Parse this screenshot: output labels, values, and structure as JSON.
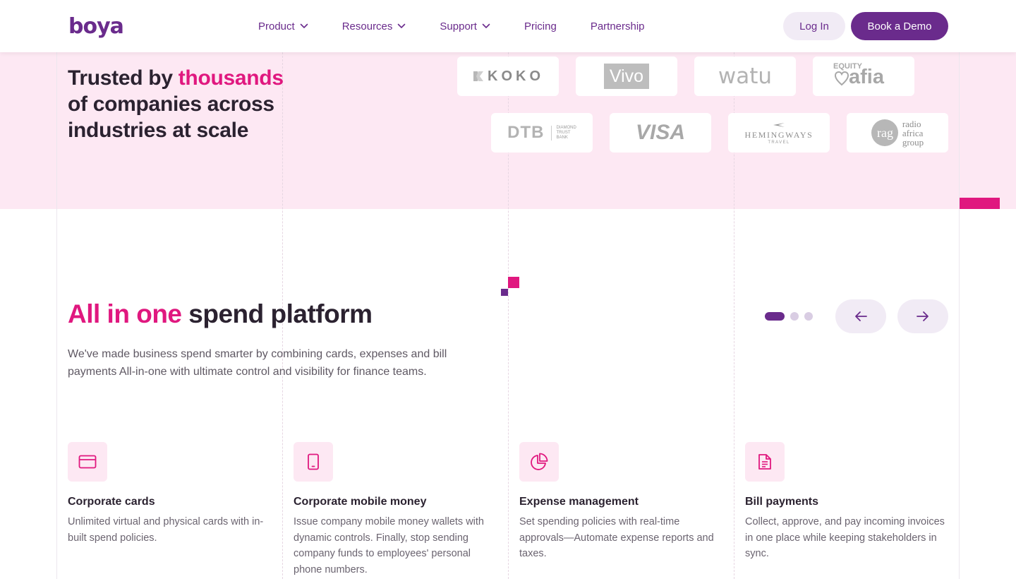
{
  "header": {
    "logo_text": "boya",
    "nav": [
      {
        "label": "Product",
        "dropdown": true
      },
      {
        "label": "Resources",
        "dropdown": true
      },
      {
        "label": "Support",
        "dropdown": true
      },
      {
        "label": "Pricing",
        "dropdown": false
      },
      {
        "label": "Partnership",
        "dropdown": false
      }
    ],
    "login_label": "Log In",
    "demo_label": "Book a Demo"
  },
  "trusted": {
    "title_part1": "Trusted by ",
    "title_highlight": "thousands",
    "title_part2": " of companies across industries at scale",
    "logos": [
      {
        "name": "KOKO"
      },
      {
        "name": "Vivo"
      },
      {
        "name": "watu"
      },
      {
        "name": "EQUITY afia",
        "top": "EQUITY",
        "main": "afia"
      },
      {
        "name": "DTB",
        "sub": [
          "DIAMOND",
          "TRUST",
          "BANK"
        ]
      },
      {
        "name": "VISA"
      },
      {
        "name": "HEMINGWAYS",
        "sub": "TRAVEL"
      },
      {
        "name": "radio africa group",
        "lines": [
          "radio",
          "africa",
          "group"
        ]
      }
    ]
  },
  "main": {
    "title_highlight": "All in one",
    "title_rest": " spend platform",
    "description": "We've made business spend smarter by combining cards, expenses and bill payments All-in-one with ultimate control and visibility for finance teams.",
    "carousel": {
      "slides": 3,
      "active": 1
    }
  },
  "features": [
    {
      "icon": "credit-card-icon",
      "title": "Corporate cards",
      "description": "Unlimited virtual and physical cards with in-built spend policies."
    },
    {
      "icon": "mobile-phone-icon",
      "title": "Corporate mobile money",
      "description": "Issue company mobile money wallets with dynamic controls. Finally, stop sending company funds to employees' personal phone numbers."
    },
    {
      "icon": "pie-chart-icon",
      "title": "Expense management",
      "description": "Set spending policies with real-time approvals—Automate expense reports and taxes."
    },
    {
      "icon": "document-icon",
      "title": "Bill payments",
      "description": "Collect, approve, and pay incoming invoices in one place while keeping stakeholders in sync."
    }
  ],
  "colors": {
    "brand_purple": "#6a2b8c",
    "brand_pink": "#e0187f",
    "band_bg": "#fde8f3"
  }
}
